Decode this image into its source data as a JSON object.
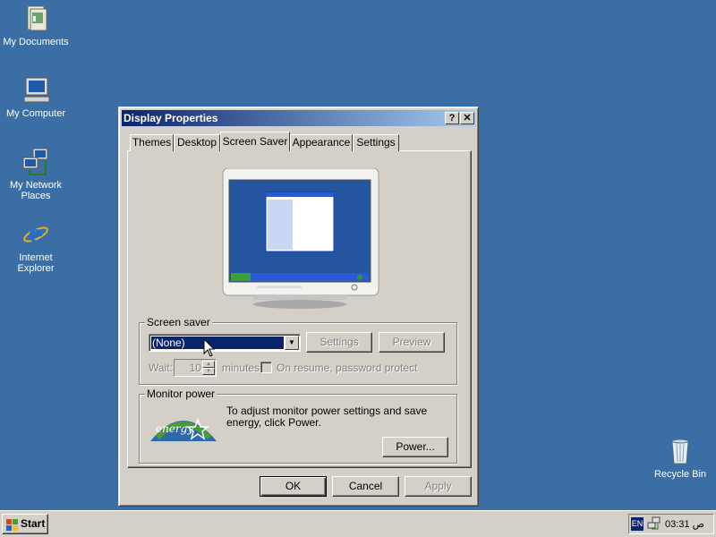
{
  "desktop": {
    "icons": [
      {
        "label": "My Documents"
      },
      {
        "label": "My Computer"
      },
      {
        "label": "My Network Places"
      },
      {
        "label": "Internet Explorer"
      },
      {
        "label": "Recycle Bin"
      }
    ]
  },
  "dialog": {
    "title": "Display Properties",
    "help_label": "?",
    "close_label": "✕",
    "tabs": [
      {
        "label": "Themes"
      },
      {
        "label": "Desktop"
      },
      {
        "label": "Screen Saver",
        "active": true
      },
      {
        "label": "Appearance"
      },
      {
        "label": "Settings"
      }
    ],
    "screen_saver": {
      "group_label": "Screen saver",
      "selected": "(None)",
      "settings_label": "Settings",
      "preview_label": "Preview",
      "wait_label": "Wait:",
      "wait_value": "10",
      "minutes_label": "minutes",
      "resume_label": "On resume, password protect"
    },
    "monitor_power": {
      "group_label": "Monitor power",
      "text": "To adjust monitor power settings and save energy, click Power.",
      "power_label": "Power...",
      "logo_text": "energy"
    },
    "buttons": {
      "ok": "OK",
      "cancel": "Cancel",
      "apply": "Apply"
    }
  },
  "taskbar": {
    "start_label": "Start",
    "language": "EN",
    "clock": "03:31 ص"
  },
  "colors": {
    "desktop": "#3a6ea5",
    "title_active": "#0a246a",
    "face": "#d4d0c8"
  }
}
